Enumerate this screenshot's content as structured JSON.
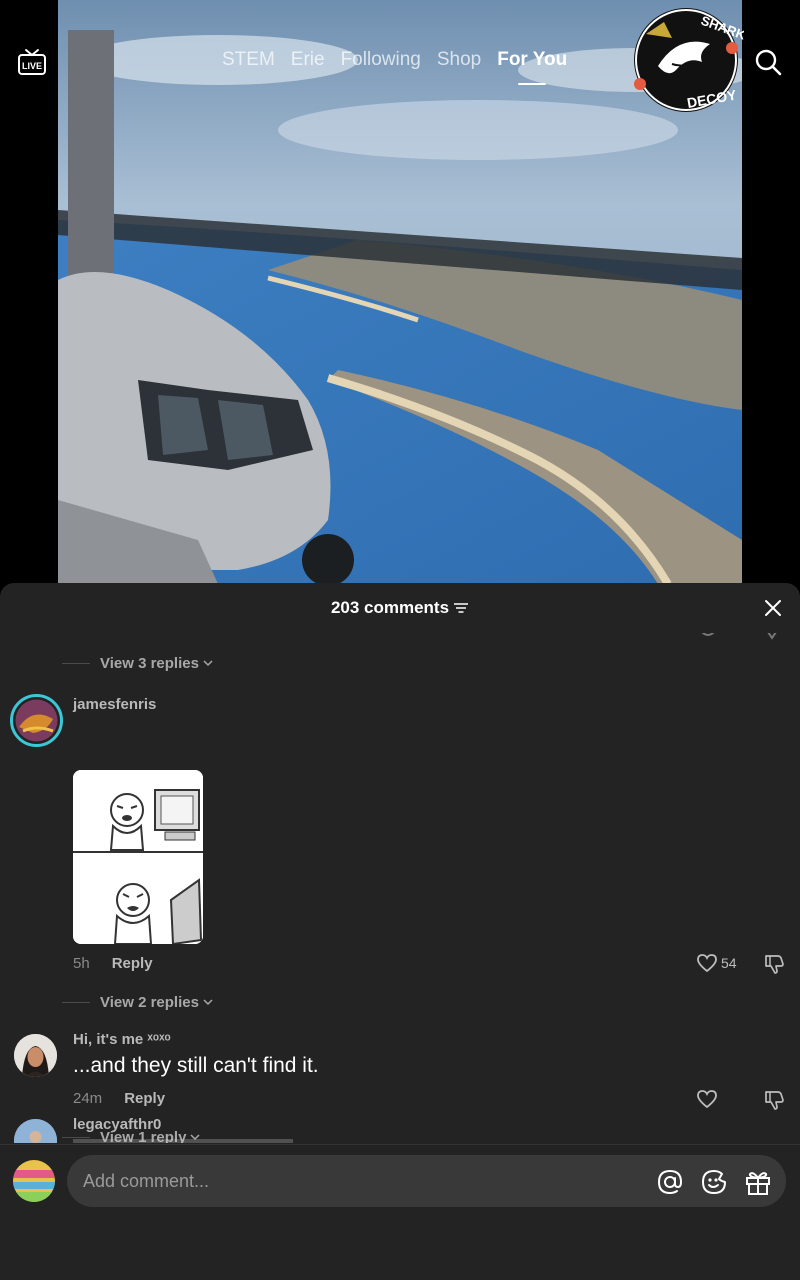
{
  "topbar": {
    "tabs": [
      "STEM",
      "Erie",
      "Following",
      "Shop",
      "For You"
    ],
    "active_tab": "For You",
    "live_label": "LIVE",
    "logo_text_top": "THE SHARK",
    "logo_text_bottom": "DECOY"
  },
  "comments_sheet": {
    "count_label": "203 comments",
    "comments": [
      {
        "view_replies": "View 3 replies"
      },
      {
        "username": "jamesfenris",
        "time": "5h",
        "reply_label": "Reply",
        "likes": "54",
        "view_replies": "View 2 replies"
      },
      {
        "username": "Hi, it's me ˣᵒˣᵒ",
        "text": "...and they still can't find it.",
        "time": "24m",
        "reply_label": "Reply",
        "view_replies": "View 1 reply"
      },
      {
        "username": "legacyafthr0"
      }
    ]
  },
  "input": {
    "placeholder": "Add comment..."
  },
  "colors": {
    "sheet_bg": "#232323",
    "input_bg": "#393939",
    "avatar_ring": "#3cc7d6"
  },
  "icons": [
    "live-icon",
    "search-icon",
    "filter-icon",
    "close-icon",
    "chevron-down-icon",
    "heart-icon",
    "dislike-icon",
    "mention-icon",
    "emoji-icon",
    "gift-icon"
  ]
}
